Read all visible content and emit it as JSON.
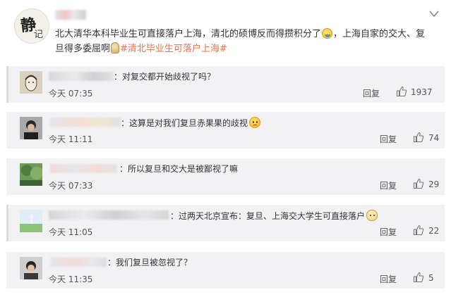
{
  "post": {
    "author_avatar_glyph_main": "静",
    "author_avatar_glyph_sub": "记",
    "text_before_emoji": "北大清华本科毕业生可直接落户上海，清北的硕博反而得攒积分了",
    "text_middle": "，上海自家的交大、复旦得多委屈啊",
    "hashtag": "#清北毕业生可落户上海#",
    "emoji_1": "sweat-smile-emoji",
    "emoji_2": "sweat-emoji",
    "menu_icon": "chevron-down-icon"
  },
  "comments": [
    {
      "text": "：对复交都开始歧视了吗？",
      "emoji": null,
      "time": "今天 07:35",
      "reply_label": "回复",
      "like_count": "1937"
    },
    {
      "text": "：这算是对我们复旦赤果果的歧视",
      "emoji": "sad-face-emoji",
      "time": "今天 11:11",
      "reply_label": "回复",
      "like_count": "74"
    },
    {
      "text": "：所以复旦和交大是被鄙视了嘛",
      "emoji": null,
      "time": "今天 07:33",
      "reply_label": "回复",
      "like_count": "29"
    },
    {
      "text": "：过两天北京宣布：复旦、上海交大学生可直接落户",
      "emoji": "cat-face-emoji",
      "time": "今天 11:05",
      "reply_label": "回复",
      "like_count": "22"
    },
    {
      "text": "：我们复旦被忽视了？",
      "emoji": null,
      "time": "今天 11:35",
      "reply_label": "回复",
      "like_count": "5"
    }
  ],
  "colors": {
    "hashtag": "#eb7350",
    "comment_bg": "#f2f2f5"
  }
}
